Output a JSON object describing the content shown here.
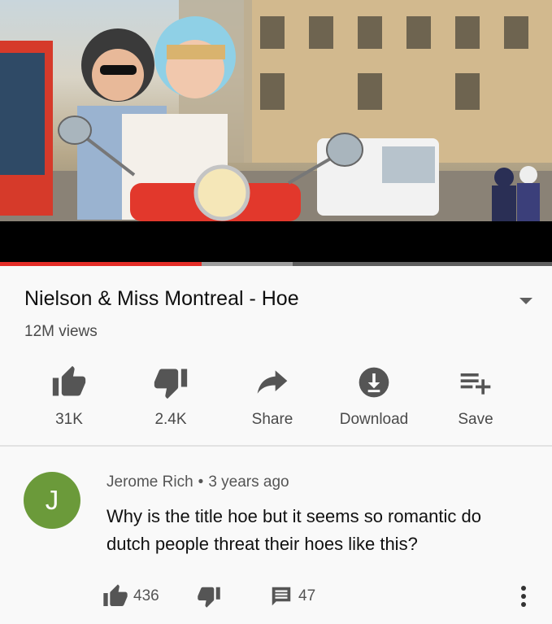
{
  "video": {
    "title": "Nielson & Miss Montreal - Hoe",
    "views": "12M views",
    "progress": {
      "played_fraction": 0.365,
      "buffered_fraction": 0.53
    }
  },
  "actions": [
    {
      "label": "31K",
      "icon": "thumbs-up-icon"
    },
    {
      "label": "2.4K",
      "icon": "thumbs-down-icon"
    },
    {
      "label": "Share",
      "icon": "share-icon"
    },
    {
      "label": "Download",
      "icon": "download-icon"
    },
    {
      "label": "Save",
      "icon": "save-to-playlist-icon"
    }
  ],
  "comment": {
    "avatar_letter": "J",
    "avatar_color": "#6b9a3a",
    "author": "Jerome Rich",
    "separator": "•",
    "time": "3 years ago",
    "text": "Why is the title hoe but it seems so romantic do dutch people threat their hoes like this?",
    "likes": "436",
    "replies": "47"
  },
  "colors": {
    "accent": "#e52d27",
    "background": "#f9f9f9",
    "icon": "#555555"
  }
}
